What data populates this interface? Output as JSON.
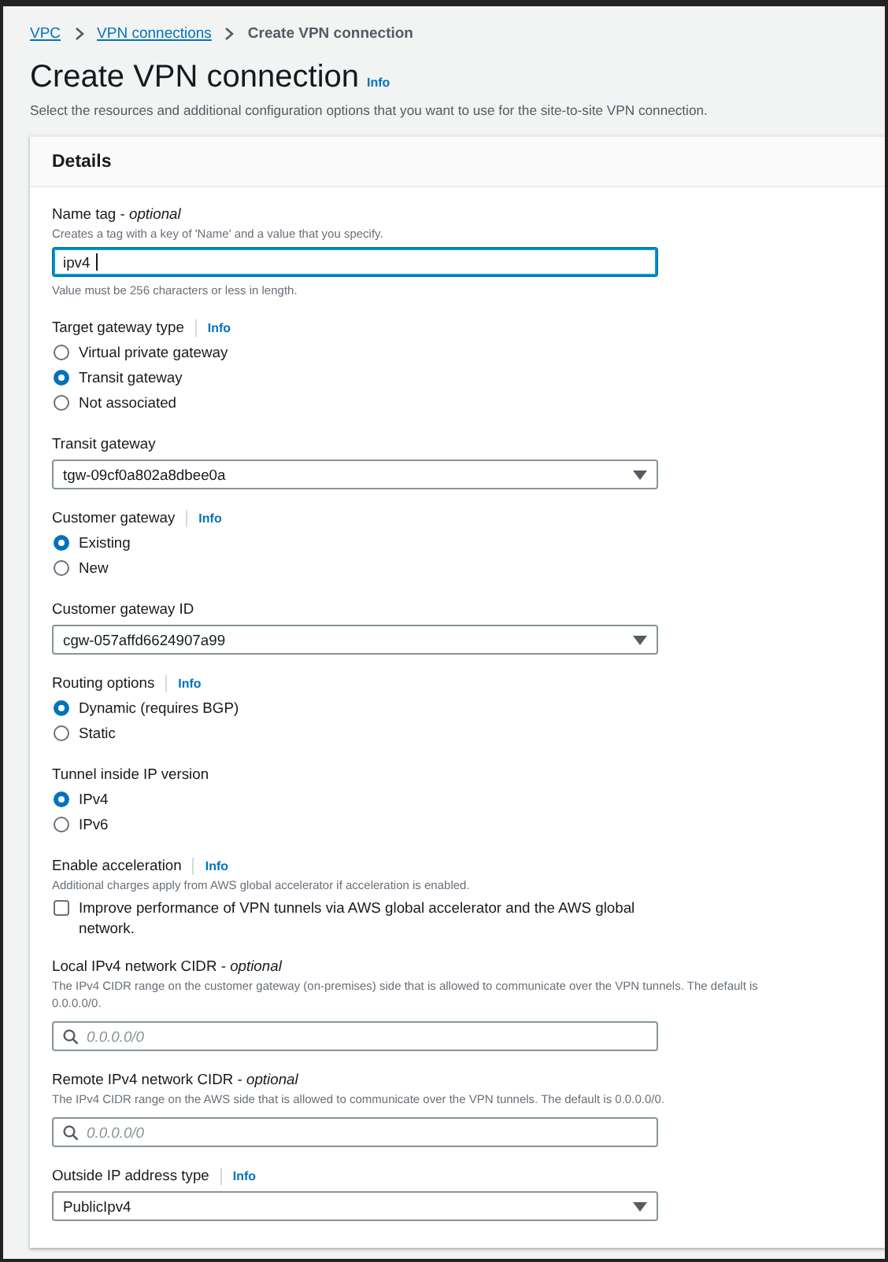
{
  "breadcrumbs": [
    {
      "label": "VPC",
      "link": true
    },
    {
      "label": "VPN connections",
      "link": true
    },
    {
      "label": "Create VPN connection",
      "link": false
    }
  ],
  "page": {
    "title": "Create VPN connection",
    "info": "Info",
    "description": "Select the resources and additional configuration options that you want to use for the site-to-site VPN connection."
  },
  "panel": {
    "title": "Details",
    "fields": [
      {
        "kind": "text",
        "label": "Name tag - *optional*",
        "hint": "Creates a tag with a key of 'Name' and a value that you specify.",
        "value": "ipv4",
        "focused": true,
        "constraint": "Value must be 256 characters or less in length."
      },
      {
        "kind": "radio",
        "label": "Target gateway type",
        "info": "Info",
        "options": [
          {
            "label": "Virtual private gateway",
            "selected": false
          },
          {
            "label": "Transit gateway",
            "selected": true
          },
          {
            "label": "Not associated",
            "selected": false
          }
        ]
      },
      {
        "kind": "select",
        "label": "Transit gateway",
        "value": "tgw-09cf0a802a8dbee0a"
      },
      {
        "kind": "radio",
        "label": "Customer gateway",
        "info": "Info",
        "options": [
          {
            "label": "Existing",
            "selected": true
          },
          {
            "label": "New",
            "selected": false
          }
        ]
      },
      {
        "kind": "select",
        "label": "Customer gateway ID",
        "value": "cgw-057affd6624907a99"
      },
      {
        "kind": "radio",
        "label": "Routing options",
        "info": "Info",
        "options": [
          {
            "label": "Dynamic (requires BGP)",
            "selected": true
          },
          {
            "label": "Static",
            "selected": false
          }
        ]
      },
      {
        "kind": "radio",
        "label": "Tunnel inside IP version",
        "options": [
          {
            "label": "IPv4",
            "selected": true
          },
          {
            "label": "IPv6",
            "selected": false
          }
        ]
      },
      {
        "kind": "checkbox",
        "label": "Enable acceleration",
        "info": "Info",
        "hint": "Additional charges apply from AWS global accelerator if acceleration is enabled.",
        "option": {
          "label": "Improve performance of VPN tunnels via AWS global accelerator and the AWS global network.",
          "checked": false
        }
      },
      {
        "kind": "search",
        "label": "Local IPv4 network CIDR - *optional*",
        "hint": "The IPv4 CIDR range on the customer gateway (on-premises) side that is allowed to communicate over the VPN tunnels. The default is 0.0.0.0/0.",
        "placeholder": "0.0.0.0/0"
      },
      {
        "kind": "search",
        "label": "Remote IPv4 network CIDR - *optional*",
        "hint": "The IPv4 CIDR range on the AWS side that is allowed to communicate over the VPN tunnels. The default is 0.0.0.0/0.",
        "placeholder": "0.0.0.0/0"
      },
      {
        "kind": "select",
        "label": "Outside IP address type",
        "info": "Info",
        "value": "PublicIpv4"
      }
    ]
  }
}
